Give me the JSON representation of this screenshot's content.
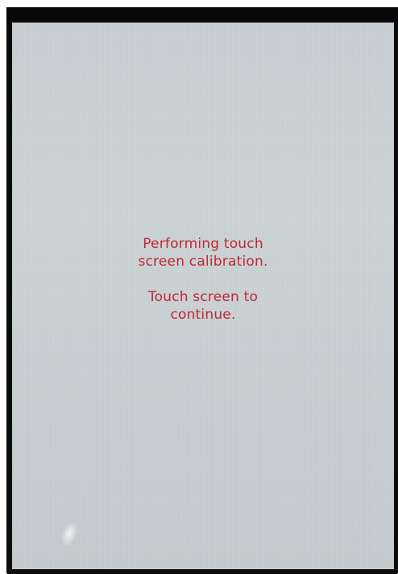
{
  "screen": {
    "background_color": "#cbd2d5",
    "text_color": "#c0273a",
    "message": {
      "line1": "Performing touch",
      "line2": "screen calibration.",
      "line3": "Touch screen to",
      "line4": "continue."
    }
  }
}
